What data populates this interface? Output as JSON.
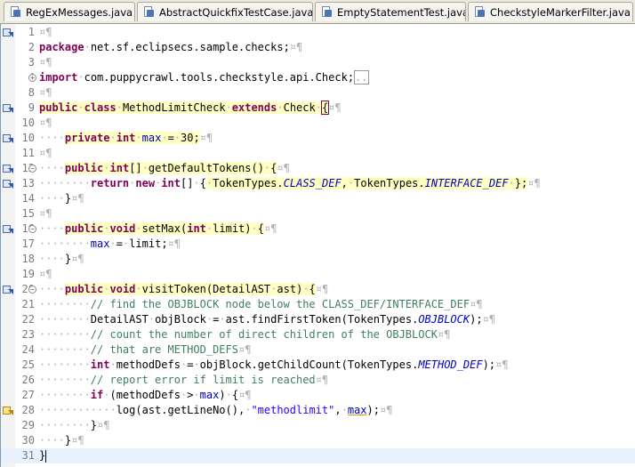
{
  "tabs": [
    {
      "label": "RegExMessages.java"
    },
    {
      "label": "AbstractQuickfixTestCase.java"
    },
    {
      "label": "EmptyStatementTest.java"
    },
    {
      "label": "CheckstyleMarkerFilter.java"
    }
  ],
  "editor": {
    "lines": [
      "1",
      "2",
      "3",
      "4",
      "8",
      "9",
      "10",
      "11",
      "12",
      "13",
      "14",
      "15",
      "16",
      "17",
      "18",
      "19",
      "20",
      "21",
      "22",
      "23",
      "24",
      "25",
      "26",
      "27",
      "28",
      "29",
      "30",
      "31"
    ],
    "package_name": "net.sf.eclipsecs.sample.checks",
    "import_name": "com.puppycrawl.tools.checkstyle.api.Check",
    "class_name": "MethodLimitCheck",
    "super_class": "Check",
    "field_name": "max",
    "field_value": "30",
    "method1": "getDefaultTokens",
    "const1": "CLASS_DEF",
    "const2": "INTERFACE_DEF",
    "method2": "setMax",
    "param_limit": "limit",
    "method3": "visitToken",
    "param_type": "DetailAST",
    "param_ast": "ast",
    "comment1": "// find the OBJBLOCK node below the CLASS_DEF/INTERFACE_DEF",
    "comment2": "// count the number of direct children of the OBJBLOCK",
    "comment3": "// that are METHOD_DEFS",
    "comment4": "// report error if limit is reached",
    "const3": "OBJBLOCK",
    "const4": "METHOD_DEF",
    "message_key": "\"methodlimit\""
  }
}
